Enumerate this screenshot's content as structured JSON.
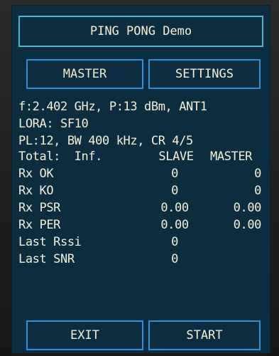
{
  "title": "PING PONG Demo",
  "buttons": {
    "master": "MASTER",
    "settings": "SETTINGS",
    "exit": "EXIT",
    "start": "START"
  },
  "info": {
    "line1": "f:2.402 GHz, P:13 dBm, ANT1",
    "line2": "LORA: SF10",
    "line3": "PL:12, BW 400 kHz, CR 4/5"
  },
  "stats": {
    "header": {
      "label": "Total:  Inf.",
      "slave": "SLAVE",
      "master": "MASTER"
    },
    "rows": [
      {
        "label": "Rx OK",
        "slave": "0",
        "master": "0"
      },
      {
        "label": "Rx KO",
        "slave": "0",
        "master": "0"
      },
      {
        "label": "Rx PSR",
        "slave": "0.00",
        "master": "0.00"
      },
      {
        "label": "Rx PER",
        "slave": "0.00",
        "master": "0.00"
      },
      {
        "label": "Last Rssi",
        "slave": "0",
        "master": ""
      },
      {
        "label": "Last SNR",
        "slave": "0",
        "master": ""
      }
    ]
  },
  "colors": {
    "screen_bg": "#0c2d3f",
    "title_border": "#4fb3cc",
    "button_border": "#2f8fd8",
    "text": "#f4f0d8"
  }
}
